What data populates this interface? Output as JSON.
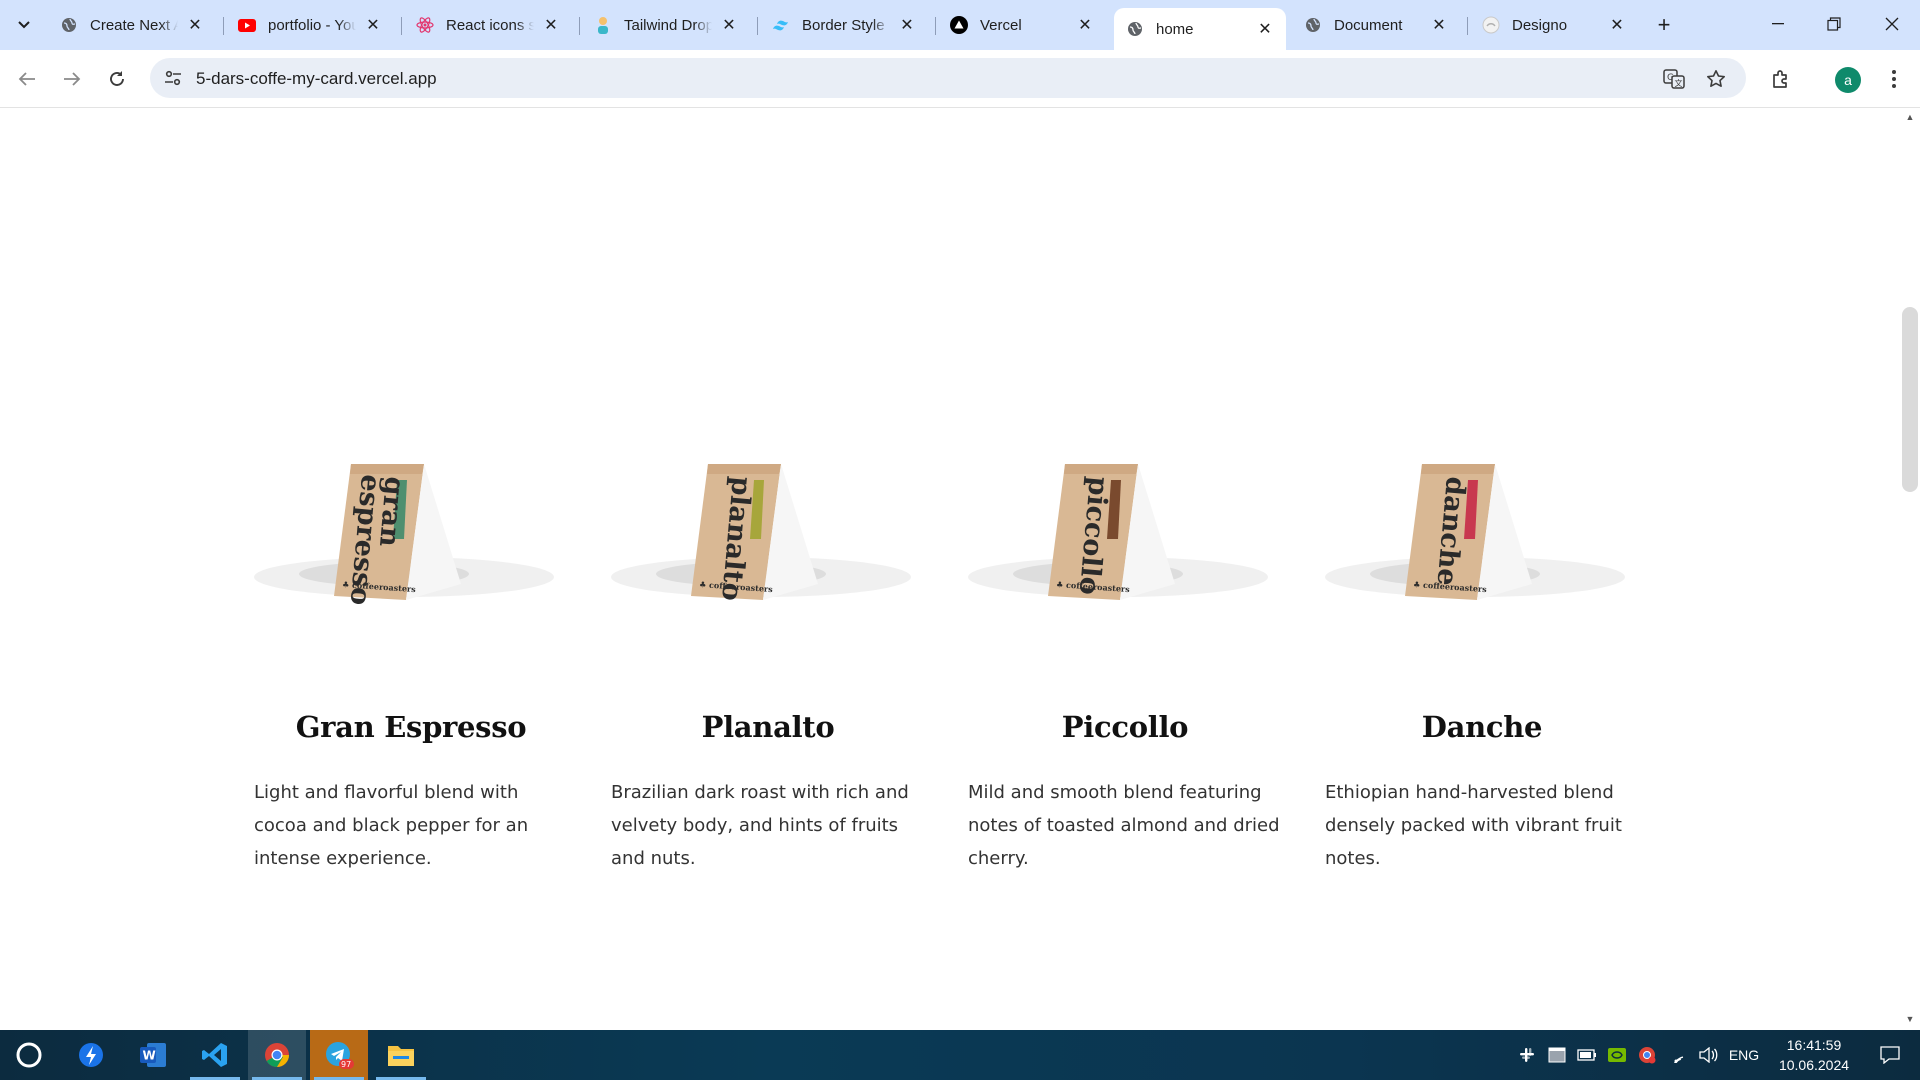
{
  "browser": {
    "tabs": [
      {
        "title": "Create Next App",
        "icon": "globe-icon"
      },
      {
        "title": "portfolio - YouTube",
        "icon": "youtube-icon"
      },
      {
        "title": "React icons search",
        "icon": "react-icon"
      },
      {
        "title": "Tailwind Dropdown",
        "icon": "person-icon"
      },
      {
        "title": "Border Style",
        "icon": "tailwind-icon"
      },
      {
        "title": "Vercel",
        "icon": "vercel-icon"
      },
      {
        "title": "home",
        "icon": "globe-icon",
        "active": true
      },
      {
        "title": "Document",
        "icon": "globe-icon"
      },
      {
        "title": "Designo",
        "icon": "designo-icon"
      }
    ],
    "url": "5-dars-coffe-my-card.vercel.app",
    "profile_initial": "a"
  },
  "products": [
    {
      "bag_label": "gran espresso",
      "name": "Gran Espresso",
      "description": "Light and flavorful blend with cocoa and black pepper for an intense experience.",
      "accent": "#4f8f6f"
    },
    {
      "bag_label": "planalto",
      "name": "Planalto",
      "description": "Brazilian dark roast with rich and velvety body, and hints of fruits and nuts.",
      "accent": "#a7a63b"
    },
    {
      "bag_label": "piccollo",
      "name": "Piccollo",
      "description": "Mild and smooth blend featuring notes of toasted almond and dried cherry.",
      "accent": "#7a4a2e"
    },
    {
      "bag_label": "danche",
      "name": "Danche",
      "description": "Ethiopian hand-harvested blend densely packed with vibrant fruit notes.",
      "accent": "#c8384f"
    }
  ],
  "bag_brand": "coffeeroasters",
  "taskbar": {
    "telegram_badge": "97",
    "language": "ENG",
    "time": "16:41:59",
    "date": "10.06.2024"
  }
}
